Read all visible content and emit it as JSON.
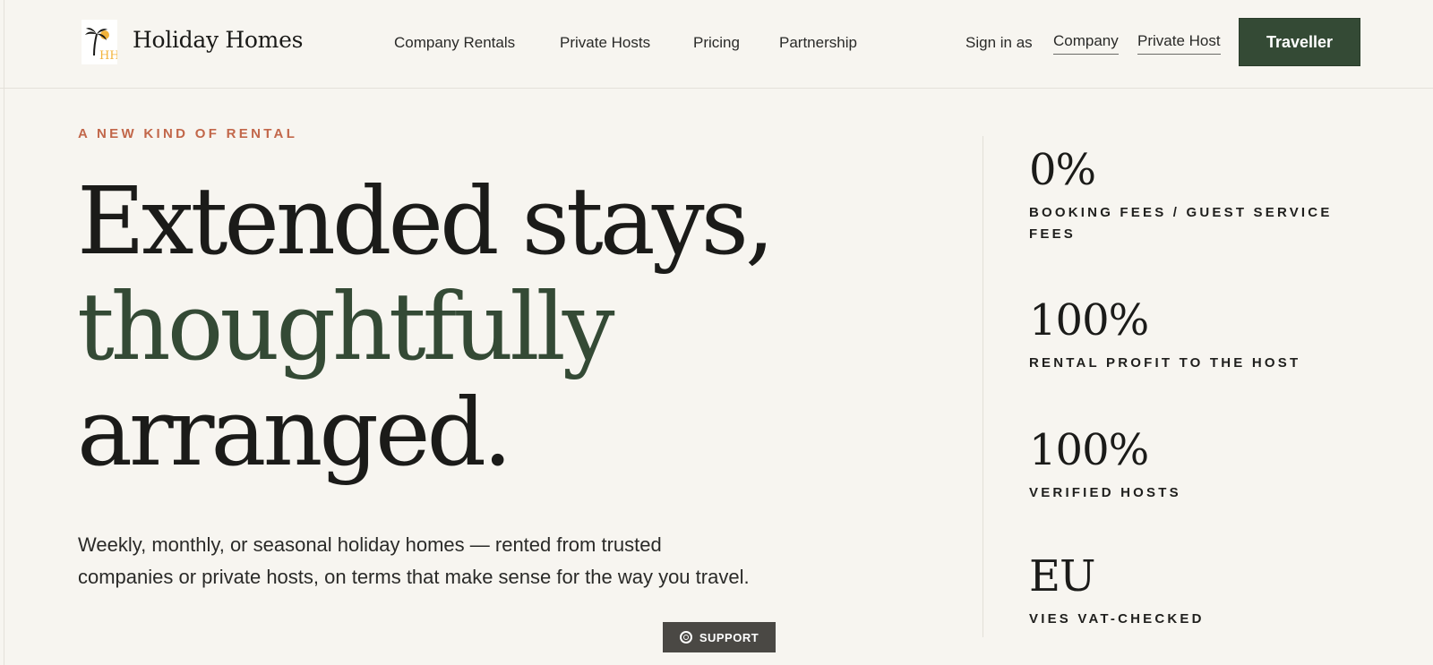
{
  "brand": {
    "name": "Holiday Homes"
  },
  "nav": {
    "items": [
      {
        "label": "Company Rentals"
      },
      {
        "label": "Private Hosts"
      },
      {
        "label": "Pricing"
      },
      {
        "label": "Partnership"
      }
    ]
  },
  "signin": {
    "label": "Sign in as",
    "company": "Company",
    "private_host": "Private Host",
    "traveller": "Traveller"
  },
  "hero": {
    "eyebrow": "A NEW KIND OF RENTAL",
    "headline_line1": "Extended stays,",
    "headline_line2": "thoughtfully",
    "headline_line3": "arranged.",
    "lead": "Weekly, monthly, or seasonal holiday homes — rented from trusted companies or private hosts, on terms that make sense for the way you travel."
  },
  "stats": [
    {
      "value": "0%",
      "label": "BOOKING FEES / GUEST SERVICE FEES"
    },
    {
      "value": "100%",
      "label": "RENTAL PROFIT TO THE HOST"
    },
    {
      "value": "100%",
      "label": "VERIFIED HOSTS"
    },
    {
      "value": "EU",
      "label": "VIES VAT-CHECKED"
    }
  ],
  "support": {
    "label": "SUPPORT"
  },
  "colors": {
    "background": "#f7f5f0",
    "accent_green": "#344a35",
    "eyebrow_terracotta": "#c2674a",
    "support_bg": "#4a4844"
  },
  "icons": {
    "logo": "palm-tree-sun-logo-icon",
    "support": "lifebuoy-icon"
  }
}
